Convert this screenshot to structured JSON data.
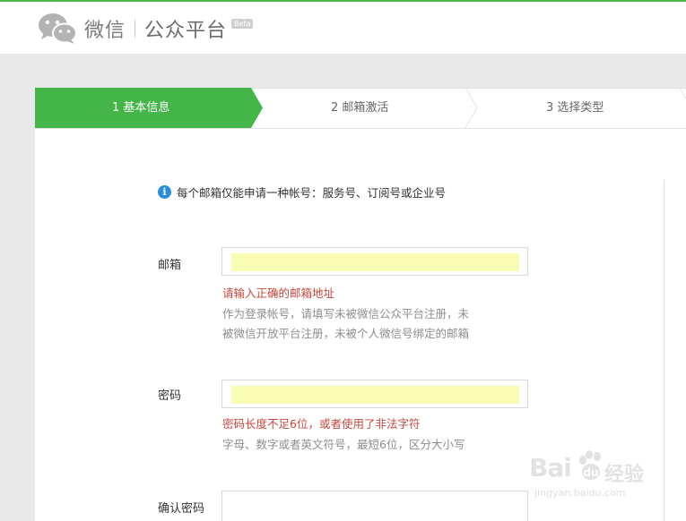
{
  "header": {
    "brand": "微信",
    "product": "公众平台",
    "beta_badge": "Beta",
    "logo_icon": "wechat-logo-icon"
  },
  "steps": [
    {
      "label": "1 基本信息",
      "active": true
    },
    {
      "label": "2 邮箱激活",
      "active": false
    },
    {
      "label": "3 选择类型",
      "active": false
    }
  ],
  "colors": {
    "accent": "#44b549",
    "error": "#c8463c",
    "hint": "#8d8d8d",
    "info": "#2a8fd8",
    "autofill": "#fafcb3"
  },
  "notice": {
    "icon": "info-icon",
    "text": "每个邮箱仅能申请一种帐号：服务号、订阅号或企业号"
  },
  "form": {
    "email": {
      "label": "邮箱",
      "value": "",
      "error": "请输入正确的邮箱地址",
      "hint_line1": "作为登录帐号，请填写未被微信公众平台注册，未",
      "hint_line2": "被微信开放平台注册，未被个人微信号绑定的邮箱"
    },
    "password": {
      "label": "密码",
      "value": "",
      "error": "密码长度不足6位，或者使用了非法字符",
      "hint": "字母、数字或者英文符号，最短6位，区分大小写"
    },
    "confirm_password": {
      "label": "确认密码",
      "value": ""
    }
  },
  "watermark": {
    "text": "Bai",
    "text_cn": "经验",
    "url": "jingyan.baidu.com",
    "icon": "baidu-paw-icon"
  }
}
